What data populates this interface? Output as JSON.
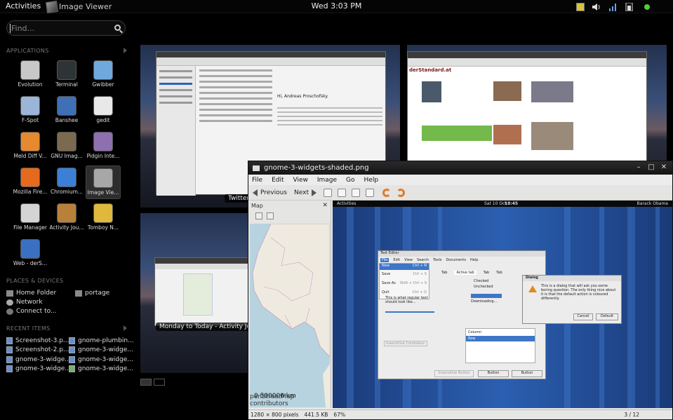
{
  "topbar": {
    "activities": "Activities",
    "app_name": "Image Viewer",
    "clock": "Wed  3:03 PM",
    "tray_icons": [
      "notes-icon",
      "volume-icon",
      "network-icon",
      "battery-icon",
      "status-icon"
    ]
  },
  "search": {
    "placeholder": "Find..."
  },
  "sections": {
    "applications": "APPLICATIONS",
    "places": "PLACES & DEVICES",
    "recent": "RECENT ITEMS"
  },
  "apps": [
    {
      "label": "Evolution",
      "icon": "evolution-icon",
      "color": "#c8c8c8"
    },
    {
      "label": "Terminal",
      "icon": "terminal-icon",
      "color": "#2e3436"
    },
    {
      "label": "Gwibber",
      "icon": "gwibber-icon",
      "color": "#6fa8dc"
    },
    {
      "label": "F-Spot",
      "icon": "fspot-icon",
      "color": "#9bb5d8"
    },
    {
      "label": "Banshee",
      "icon": "banshee-icon",
      "color": "#3f6fb4"
    },
    {
      "label": "gedit",
      "icon": "gedit-icon",
      "color": "#e8e8e8"
    },
    {
      "label": "Meld Diff V...",
      "icon": "meld-icon",
      "color": "#e6892f"
    },
    {
      "label": "GNU Imag...",
      "icon": "gimp-icon",
      "color": "#7b6a4f"
    },
    {
      "label": "Pidgin Inte...",
      "icon": "pidgin-icon",
      "color": "#8e6fb0"
    },
    {
      "label": "Mozilla Fire...",
      "icon": "firefox-icon",
      "color": "#e66a1e"
    },
    {
      "label": "Chromium...",
      "icon": "chromium-icon",
      "color": "#3c7fd6"
    },
    {
      "label": "Image Vie...",
      "icon": "image-viewer-icon",
      "color": "#a7a7a7"
    },
    {
      "label": "File Manager",
      "icon": "file-manager-icon",
      "color": "#d4d4d4"
    },
    {
      "label": "Activity Jou...",
      "icon": "activity-journal-icon",
      "color": "#b9803a"
    },
    {
      "label": "Tomboy N...",
      "icon": "tomboy-icon",
      "color": "#e0b83c"
    },
    {
      "label": "Web - derS...",
      "icon": "web-icon",
      "color": "#3a6fc2"
    }
  ],
  "places": [
    {
      "label": "Home Folder",
      "icon": "home-folder-icon"
    },
    {
      "label": "portage",
      "icon": "folder-icon"
    },
    {
      "label": "Network",
      "icon": "network-icon"
    },
    {
      "label": "Connect to...",
      "icon": "connect-icon"
    }
  ],
  "recent": [
    {
      "label": "Screenshot-3.p..."
    },
    {
      "label": "gnome-plumbin..."
    },
    {
      "label": "Screenshot-2.p..."
    },
    {
      "label": "gnome-3-widge..."
    },
    {
      "label": "gnome-3-widge..."
    },
    {
      "label": "gnome-3-widge..."
    },
    {
      "label": "gnome-3-widge..."
    },
    {
      "label": "gnome-3-widge..."
    }
  ],
  "windows": {
    "twitter_caption": "Twitter",
    "journal_caption": "Monday to Today - Activity Jour...",
    "mail_heading": "Hi, Andreas Proschofsky.",
    "web_site": "derStandard.at"
  },
  "viewer": {
    "title": "gnome-3-widgets-shaded.png",
    "menu": [
      "File",
      "Edit",
      "View",
      "Image",
      "Go",
      "Help"
    ],
    "previous": "Previous",
    "next": "Next",
    "sidebar_title": "Map",
    "map_scale": "0 500000 km",
    "map_attr": "penStreetMap contributors",
    "status_size": "1280 × 800 pixels",
    "status_bytes": "441.5 KB",
    "status_zoom": "67%",
    "status_position": "3 / 12"
  },
  "inner": {
    "activities": "Activities",
    "date": "Sat 10 Oct",
    "time": "18:45",
    "user": "Barack Obama",
    "editor_title": "Text Editor",
    "editor_menu": [
      "File",
      "Edit",
      "View",
      "Search",
      "Tools",
      "Documents",
      "Help"
    ],
    "file_menu": [
      "New",
      "Save",
      "Save As",
      "Quit"
    ],
    "file_menu_keys": [
      "Ctrl + N",
      "Ctrl + S",
      "Shift + Ctrl + S",
      "Ctrl + Q"
    ],
    "tabs": [
      "Tab",
      "Active tab",
      "Tab",
      "Tab"
    ],
    "checked": "Checked",
    "unchecked": "Unchecked",
    "regular_text": "This is what regular text should look like...",
    "downloading": "Downloading...",
    "column": "Column",
    "row": "Row",
    "combo": "Insensitive Combobox",
    "buttons": [
      "Insensitive Button",
      "Button",
      "Button"
    ],
    "dialog_title": "Dialog",
    "dialog_text": "This is a dialog that will ask you some boring question. The only thing nice about it is that the default action is coloured differently.",
    "dialog_cancel": "Cancel",
    "dialog_default": "Default"
  }
}
